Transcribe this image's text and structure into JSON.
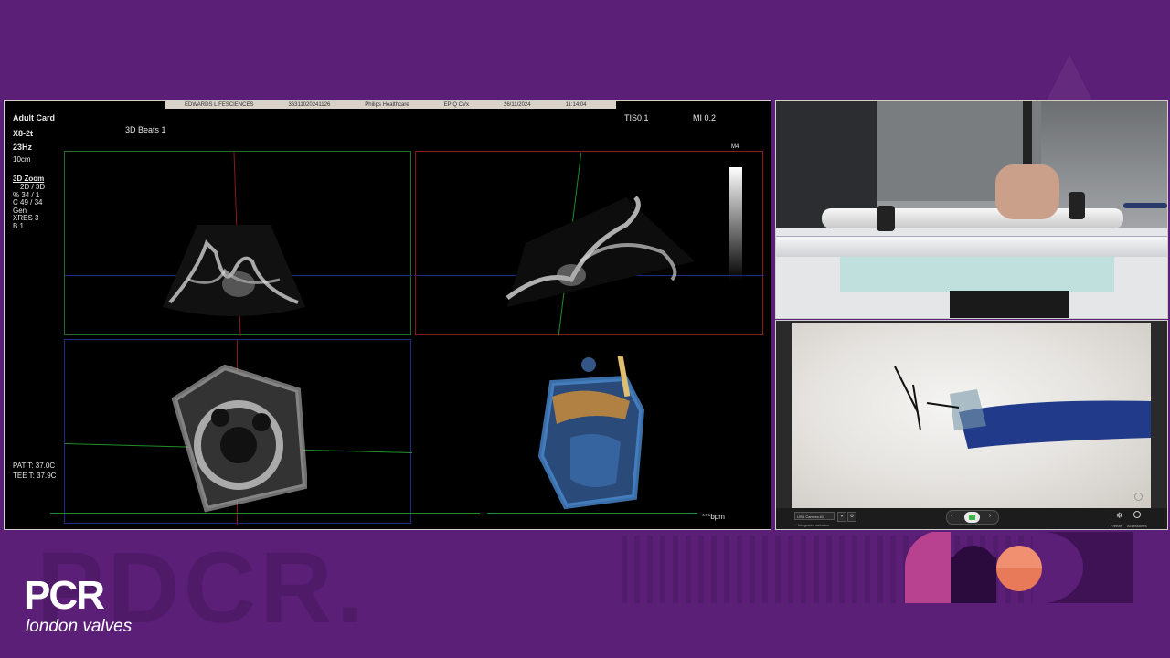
{
  "ultrasound": {
    "header": {
      "vendor": "EDWARDS LIFESCIENCES",
      "id": "36311020241126",
      "maker": "Philips Healthcare",
      "model": "EPIQ CVx",
      "date": "26/11/2024",
      "time": "11:14:04"
    },
    "preset": "Adult Card",
    "probe": "X8-2t",
    "frame_rate": "23Hz",
    "depth": "10cm",
    "beats": "3D Beats 1",
    "tis": "TIS0.1",
    "mi": "MI 0.2",
    "map": "M4",
    "zoom_title": "3D Zoom",
    "zoom_lines": [
      "2D / 3D",
      "% 34 / 1",
      "C  49 / 34",
      "Gen",
      "XRES 3",
      "B 1"
    ],
    "pat_temp": "PAT T: 37.0C",
    "tee_temp": "TEE T: 37.9C",
    "bpm": "***bpm"
  },
  "camera": {
    "source": "USB Camera #1",
    "sub": "Integrated webcam",
    "freeze": "Freeze",
    "accessories": "Accessories"
  },
  "branding": {
    "logo": "PCR",
    "subtitle": "london valves"
  },
  "colors": {
    "background": "#5b1f78",
    "green_axis": "#1f8f2a",
    "red_axis": "#b01818",
    "blue_axis": "#1a2a9a"
  }
}
